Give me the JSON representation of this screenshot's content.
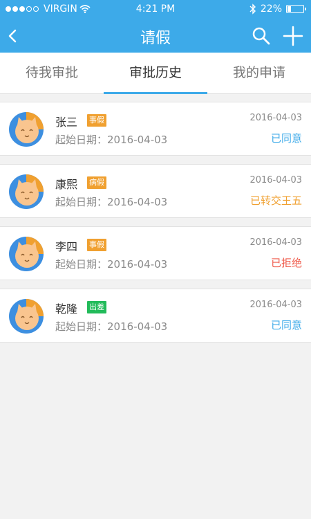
{
  "status_bar": {
    "carrier": "VIRGIN",
    "time": "4:21 PM",
    "battery": "22%",
    "battery_level": 0.22
  },
  "nav": {
    "title": "请假"
  },
  "tabs": [
    {
      "label": "待我审批",
      "active": false
    },
    {
      "label": "审批历史",
      "active": true
    },
    {
      "label": "我的申请",
      "active": false
    }
  ],
  "start_label": "起始日期：",
  "records": [
    {
      "name": "张三",
      "type": "事假",
      "type_color": "#f0a030",
      "start_date": "2016-04-03",
      "date": "2016-04-03",
      "status": "已同意",
      "status_color": "#3daae9"
    },
    {
      "name": "康熙",
      "type": "病假",
      "type_color": "#f0a030",
      "start_date": "2016-04-03",
      "date": "2016-04-03",
      "status": "已转交王五",
      "status_color": "#f0a030"
    },
    {
      "name": "李四",
      "type": "事假",
      "type_color": "#f0a030",
      "start_date": "2016-04-03",
      "date": "2016-04-03",
      "status": "已拒绝",
      "status_color": "#ef5a4a"
    },
    {
      "name": "乾隆",
      "type": "出差",
      "type_color": "#22bb5a",
      "start_date": "2016-04-03",
      "date": "2016-04-03",
      "status": "已同意",
      "status_color": "#3daae9"
    }
  ],
  "colors": {
    "primary": "#3daae9"
  }
}
